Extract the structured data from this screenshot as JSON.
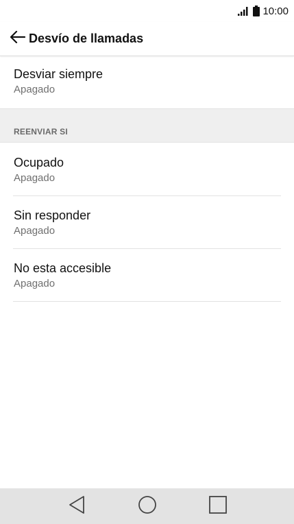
{
  "status_bar": {
    "time": "10:00",
    "signal_icon": "signal-icon",
    "battery_icon": "battery-icon"
  },
  "app_bar": {
    "title": "Desvío de llamadas",
    "back_icon": "back-arrow-icon"
  },
  "items_top": [
    {
      "title": "Desviar siempre",
      "subtitle": "Apagado"
    }
  ],
  "section": {
    "label": "REENVIAR SI"
  },
  "items_section": [
    {
      "title": "Ocupado",
      "subtitle": "Apagado"
    },
    {
      "title": "Sin responder",
      "subtitle": "Apagado"
    },
    {
      "title": "No esta accesible",
      "subtitle": "Apagado"
    }
  ],
  "nav_bar": {
    "back_icon": "nav-back-icon",
    "home_icon": "nav-home-icon",
    "recents_icon": "nav-recents-icon"
  },
  "colors": {
    "nav_bar_bg": "#e3e3e3",
    "section_bg": "#efefef",
    "subtitle_text": "#6f6f6f",
    "nav_icon": "#444444"
  }
}
